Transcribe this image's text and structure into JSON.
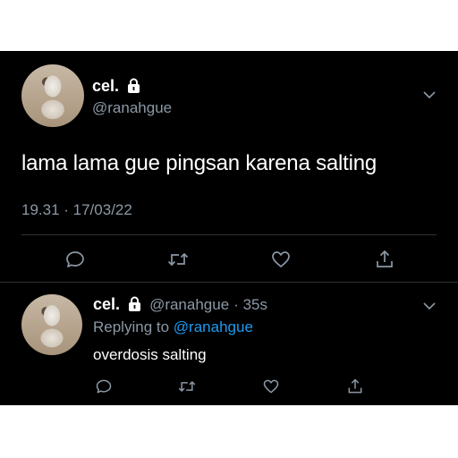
{
  "main_tweet": {
    "display_name": "cel.",
    "handle": "@ranahgue",
    "text": "lama lama gue pingsan karena salting",
    "timestamp": "19.31 · 17/03/22"
  },
  "reply_tweet": {
    "display_name": "cel.",
    "handle": "@ranahgue",
    "time": "· 35s",
    "replying_prefix": "Replying to",
    "replying_to": "@ranahgue",
    "text": "overdosis salting"
  },
  "icons": [
    "lock-icon",
    "chevron-down-icon",
    "reply-icon",
    "retweet-icon",
    "like-icon",
    "share-icon"
  ],
  "colors": {
    "background": "#000000",
    "text": "#ffffff",
    "muted": "#8b98a5",
    "link": "#1d9bf0",
    "divider": "#2f3336"
  }
}
